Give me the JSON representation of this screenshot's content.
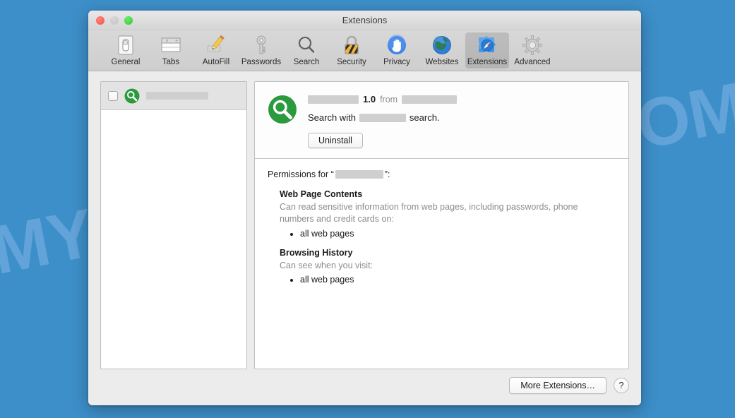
{
  "watermark": {
    "text": "MYANTISPYWARE.COM",
    "color": "#96bef0"
  },
  "desktop": {
    "background_color": "#3d8fc9"
  },
  "window": {
    "title": "Extensions",
    "traffic_lights": [
      {
        "name": "close",
        "color": "#f2544b"
      },
      {
        "name": "minimize",
        "color": "#c3c3c3"
      },
      {
        "name": "zoom",
        "color": "#2ecb2e"
      }
    ]
  },
  "toolbar": {
    "items": [
      {
        "label": "General",
        "icon": "general-icon",
        "selected": false
      },
      {
        "label": "Tabs",
        "icon": "tabs-icon",
        "selected": false
      },
      {
        "label": "AutoFill",
        "icon": "autofill-icon",
        "selected": false
      },
      {
        "label": "Passwords",
        "icon": "passwords-icon",
        "selected": false
      },
      {
        "label": "Search",
        "icon": "search-icon",
        "selected": false
      },
      {
        "label": "Security",
        "icon": "security-icon",
        "selected": false
      },
      {
        "label": "Privacy",
        "icon": "privacy-icon",
        "selected": false
      },
      {
        "label": "Websites",
        "icon": "websites-icon",
        "selected": false
      },
      {
        "label": "Extensions",
        "icon": "extensions-icon",
        "selected": true
      },
      {
        "label": "Advanced",
        "icon": "advanced-icon",
        "selected": false
      }
    ]
  },
  "extension_list": {
    "rows": [
      {
        "checked": false,
        "icon": "green-magnifier-icon",
        "name_redacted": true,
        "name_redaction_width": 88
      }
    ]
  },
  "detail": {
    "icon": "green-magnifier-icon",
    "name_redacted": true,
    "name_redaction_width": 72,
    "version": "1.0",
    "from_label": "from",
    "publisher_redacted": true,
    "publisher_redaction_width": 78,
    "description_prefix": "Search with",
    "description_redaction_width": 66,
    "description_suffix": "search.",
    "uninstall_label": "Uninstall",
    "permissions_prefix": "Permissions for “",
    "permissions_redaction_width": 68,
    "permissions_suffix": "”:",
    "permission_groups": [
      {
        "heading": "Web Page Contents",
        "description": "Can read sensitive information from web pages, including passwords, phone numbers and credit cards on:",
        "items": [
          "all web pages"
        ]
      },
      {
        "heading": "Browsing History",
        "description": "Can see when you visit:",
        "items": [
          "all web pages"
        ]
      }
    ]
  },
  "footer": {
    "more_extensions_label": "More Extensions…",
    "help_label": "?"
  }
}
